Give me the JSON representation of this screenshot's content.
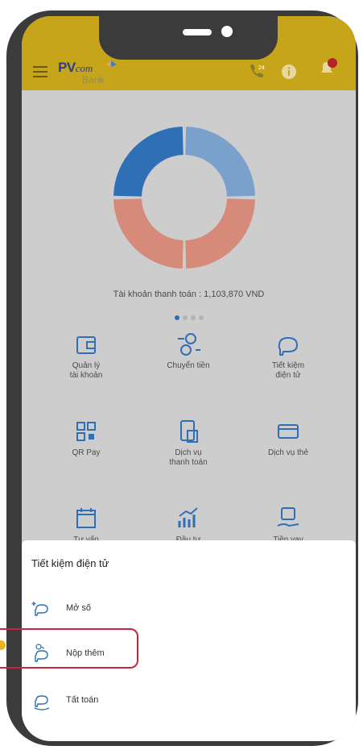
{
  "header": {
    "brand": "PV",
    "brand_script": "com",
    "brand_sub": "Bank",
    "hotline_badge": "24"
  },
  "summary": {
    "account_text": "Tài khoản thanh toán : 1,103,870 VND",
    "slide_count": 4,
    "active_slide": 1,
    "donut_colors": [
      "#2f6fb5",
      "#7aa0cc",
      "#d68a7a",
      "#d68a7a"
    ]
  },
  "services": [
    {
      "label": "Quản lý\ntài khoản",
      "icon": "wallet-icon"
    },
    {
      "label": "Chuyển tiền",
      "icon": "transfer-icon"
    },
    {
      "label": "Tiết kiệm\nđiện tử",
      "icon": "piggy-bank-icon"
    },
    {
      "label": "QR Pay",
      "icon": "qr-code-icon"
    },
    {
      "label": "Dịch vụ\nthanh toán",
      "icon": "bill-payment-icon"
    },
    {
      "label": "Dịch vụ thẻ",
      "icon": "card-icon"
    },
    {
      "label": "Tư vấn",
      "icon": "calendar-icon"
    },
    {
      "label": "Đầu tư",
      "icon": "investment-chart-icon"
    },
    {
      "label": "Tiền vay",
      "icon": "loan-icon"
    }
  ],
  "sheet": {
    "title": "Tiết kiệm điện tử",
    "options": [
      {
        "label": "Mở số",
        "icon": "piggy-plus-icon"
      },
      {
        "label": "Nộp thêm",
        "icon": "piggy-deposit-icon"
      },
      {
        "label": "Tất toán",
        "icon": "piggy-withdraw-icon"
      }
    ]
  },
  "colors": {
    "header": "#c7a51a",
    "accent": "#2f6fb5",
    "highlight": "#c8243a",
    "marker": "#e7b624"
  }
}
